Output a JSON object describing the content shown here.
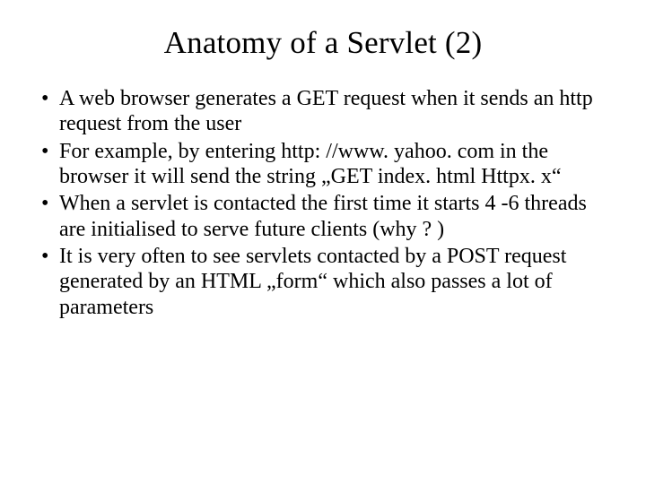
{
  "slide": {
    "title": "Anatomy of a Servlet (2)",
    "bullets": [
      "A web browser generates  a GET request when it sends an http request from the user",
      "For example, by entering http: //www. yahoo. com in the browser it will send the string  „GET index. html Httpx. x“",
      "When a servlet is contacted the first time it starts 4 -6 threads are initialised to serve future clients (why ? )",
      "It is very often to see servlets contacted by a POST request generated by an HTML „form“ which also passes a lot of parameters"
    ]
  }
}
